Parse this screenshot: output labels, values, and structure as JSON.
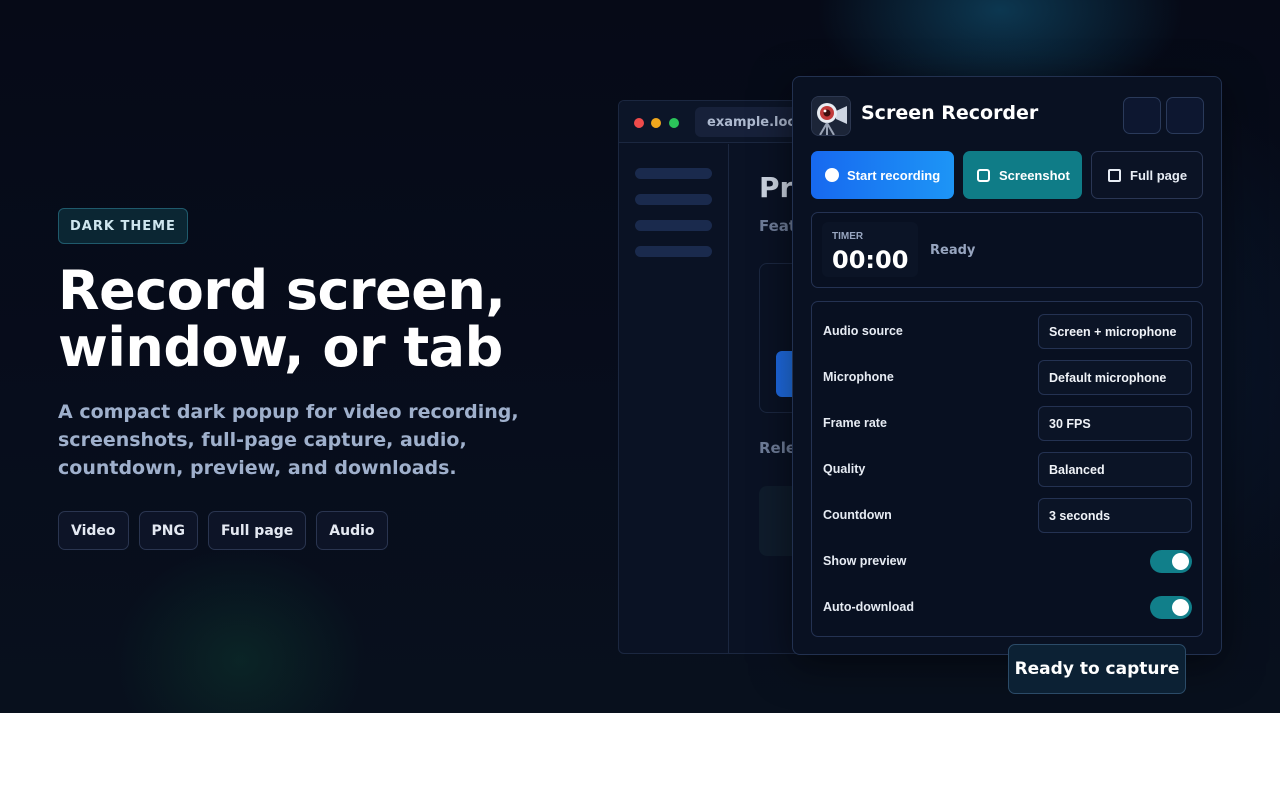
{
  "hero": {
    "badge": "DARK THEME",
    "headline_line1": "Record screen,",
    "headline_line2": "window, or tab",
    "subtitle": "A compact dark popup for video recording, screenshots, full-page capture, audio, countdown, preview, and downloads.",
    "chips": [
      "Video",
      "PNG",
      "Full page",
      "Audio"
    ]
  },
  "browser_mock": {
    "url": "example.local",
    "title_fragment": "Pr",
    "subtitle_fragment": "Feat",
    "section_fragment": "Rele"
  },
  "popup": {
    "app_icon": "camera-reel-icon",
    "title": "Screen Recorder",
    "actions": {
      "start_recording": "Start recording",
      "screenshot": "Screenshot",
      "full_page": "Full page"
    },
    "timer": {
      "label": "TIMER",
      "value": "00:00",
      "status": "Ready"
    },
    "settings": {
      "audio_source": {
        "label": "Audio source",
        "value": "Screen + microphone"
      },
      "microphone": {
        "label": "Microphone",
        "value": "Default microphone"
      },
      "frame_rate": {
        "label": "Frame rate",
        "value": "30 FPS"
      },
      "quality": {
        "label": "Quality",
        "value": "Balanced"
      },
      "countdown": {
        "label": "Countdown",
        "value": "3 seconds"
      },
      "show_preview": {
        "label": "Show preview",
        "on": true
      },
      "auto_download": {
        "label": "Auto-download",
        "on": true
      }
    }
  },
  "status_pill": "Ready to capture",
  "colors": {
    "accent_blue": "#1769f0",
    "accent_teal": "#0f7c87",
    "background": "#060a17"
  }
}
